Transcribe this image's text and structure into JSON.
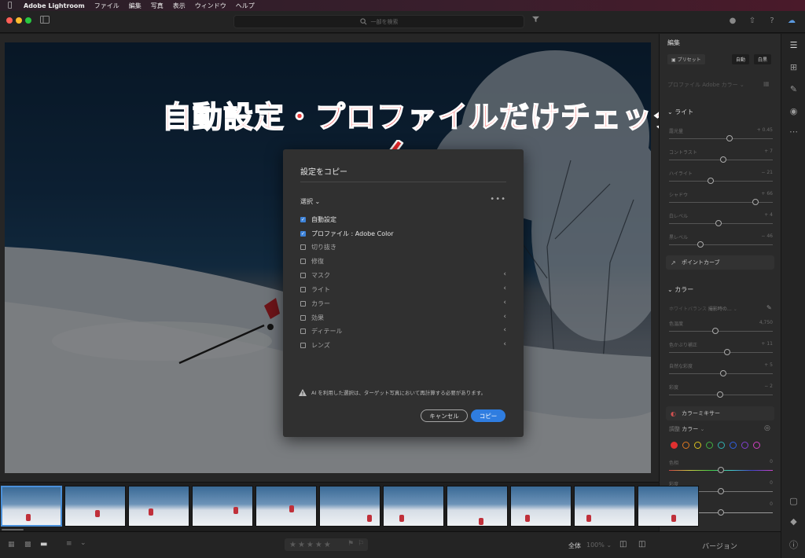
{
  "menubar": {
    "app": "Adobe Lightroom",
    "items": [
      "ファイル",
      "編集",
      "写真",
      "表示",
      "ウィンドウ",
      "ヘルプ"
    ]
  },
  "search": {
    "placeholder": "一部を検索"
  },
  "edit_panel": {
    "title": "編集",
    "preset": "プリセット",
    "auto": "自動",
    "bw": "白黒",
    "profile_label": "プロファイル",
    "profile_value": "Adobe カラー",
    "light": {
      "title": "ライト",
      "sliders": [
        {
          "label": "露光量",
          "value": "+ 0.45",
          "level": 0.58
        },
        {
          "label": "コントラスト",
          "value": "+ 7",
          "level": 0.52
        },
        {
          "label": "ハイライト",
          "value": "− 21",
          "level": 0.4
        },
        {
          "label": "シャドウ",
          "value": "+ 66",
          "level": 0.83
        },
        {
          "label": "白レベル",
          "value": "+ 4",
          "level": 0.48
        },
        {
          "label": "黒レベル",
          "value": "− 46",
          "level": 0.3
        }
      ],
      "point_curve": "ポイントカーブ"
    },
    "color": {
      "title": "カラー",
      "white_balance": "ホワイトバランス",
      "wb_value": "撮影時の…",
      "sliders": [
        {
          "label": "色温度",
          "value": "4,750",
          "level": 0.45
        },
        {
          "label": "色かぶり補正",
          "value": "+ 11",
          "level": 0.56
        },
        {
          "label": "自然な彩度",
          "value": "+ 5",
          "level": 0.52
        },
        {
          "label": "彩度",
          "value": "− 2",
          "level": 0.49
        }
      ],
      "mixer": "カラーミキサー",
      "adjust_label": "調整",
      "adjust_value": "カラー",
      "mixer_sliders": [
        {
          "label": "色相",
          "value": "0",
          "level": 0.5
        },
        {
          "label": "彩度",
          "value": "0",
          "level": 0.5
        },
        {
          "label": "輝度",
          "value": "0",
          "level": 0.5
        }
      ],
      "swatches": [
        "#e03030",
        "#e07820",
        "#d8c020",
        "#40b040",
        "#30b0b0",
        "#3060e0",
        "#8040d0",
        "#d040c0"
      ]
    }
  },
  "dialog": {
    "title": "設定をコピー",
    "select_label": "選択",
    "options": [
      {
        "label": "自動設定",
        "checked": true,
        "expandable": false
      },
      {
        "label": "プロファイル : Adobe Color",
        "checked": true,
        "expandable": false
      },
      {
        "label": "切り抜き",
        "checked": false,
        "expandable": false
      },
      {
        "label": "修復",
        "checked": false,
        "expandable": false
      },
      {
        "label": "マスク",
        "checked": false,
        "expandable": true
      },
      {
        "label": "ライト",
        "checked": false,
        "expandable": true
      },
      {
        "label": "カラー",
        "checked": false,
        "expandable": true
      },
      {
        "label": "効果",
        "checked": false,
        "expandable": true
      },
      {
        "label": "ディテール",
        "checked": false,
        "expandable": true
      },
      {
        "label": "レンズ",
        "checked": false,
        "expandable": true
      }
    ],
    "warning": "AI を利用した選択は、ターゲット写真において再計算する必要があります。",
    "cancel": "キャンセル",
    "copy": "コピー"
  },
  "annotation": "自動設定・プロファイルだけチェック",
  "bottombar": {
    "stars": "★★★★★",
    "fit": "全体",
    "zoom": "100%",
    "version": "バージョン"
  }
}
